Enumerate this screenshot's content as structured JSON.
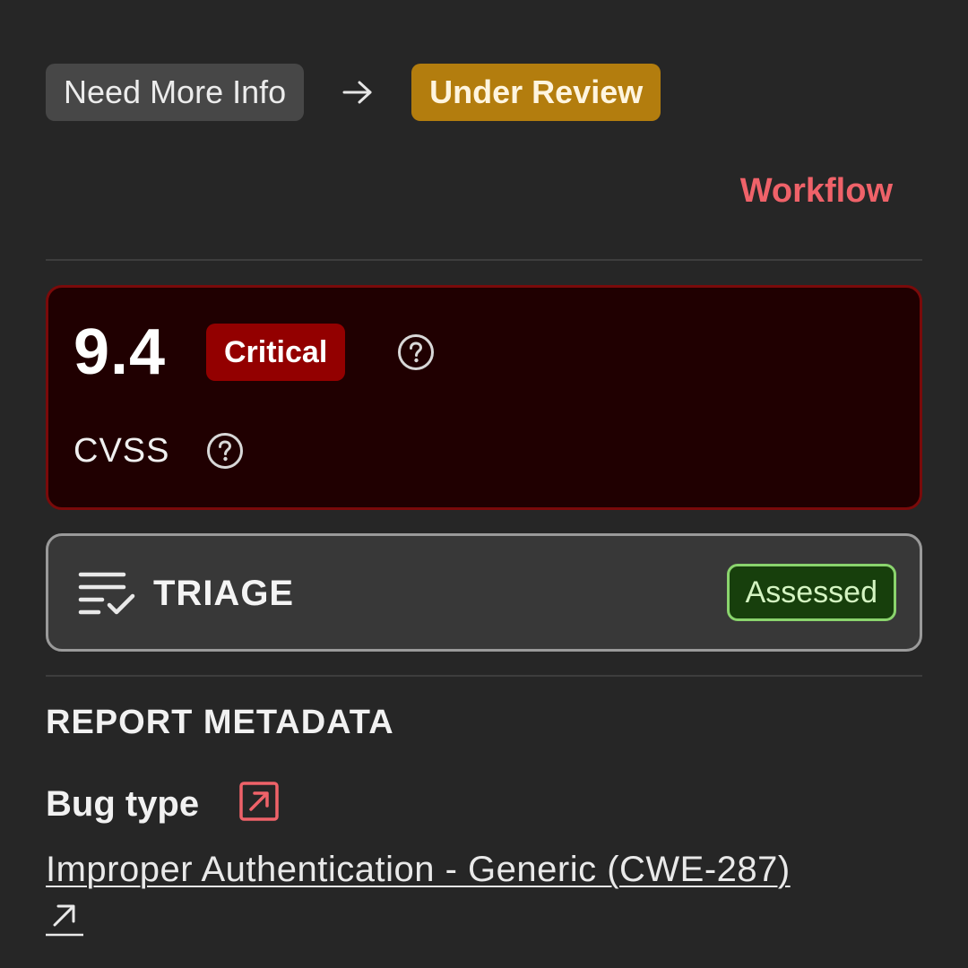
{
  "status_transition": {
    "from": "Need More Info",
    "to": "Under Review",
    "arrow_icon": "arrow-right-icon"
  },
  "workflow_link": "Workflow",
  "cvss": {
    "score": "9.4",
    "severity": "Critical",
    "label": "CVSS",
    "help_icon": "question-circle-icon"
  },
  "triage": {
    "icon": "list-check-icon",
    "title": "TRIAGE",
    "status": "Assessed"
  },
  "report_metadata": {
    "heading": "REPORT METADATA",
    "bug_type_label": "Bug type",
    "bug_type_label_icon": "external-link-icon",
    "bug_type_value": "Improper Authentication - Generic (CWE-287)",
    "bug_type_link_icon": "arrow-up-right-icon"
  },
  "colors": {
    "background": "#262626",
    "accent_link": "#ef6269",
    "status_under_review": "#b37d0e",
    "severity_critical": "#930000",
    "cvss_card_bg": "#200001",
    "triage_assessed_border": "#8ad46d",
    "triage_assessed_bg": "#173f0c"
  }
}
